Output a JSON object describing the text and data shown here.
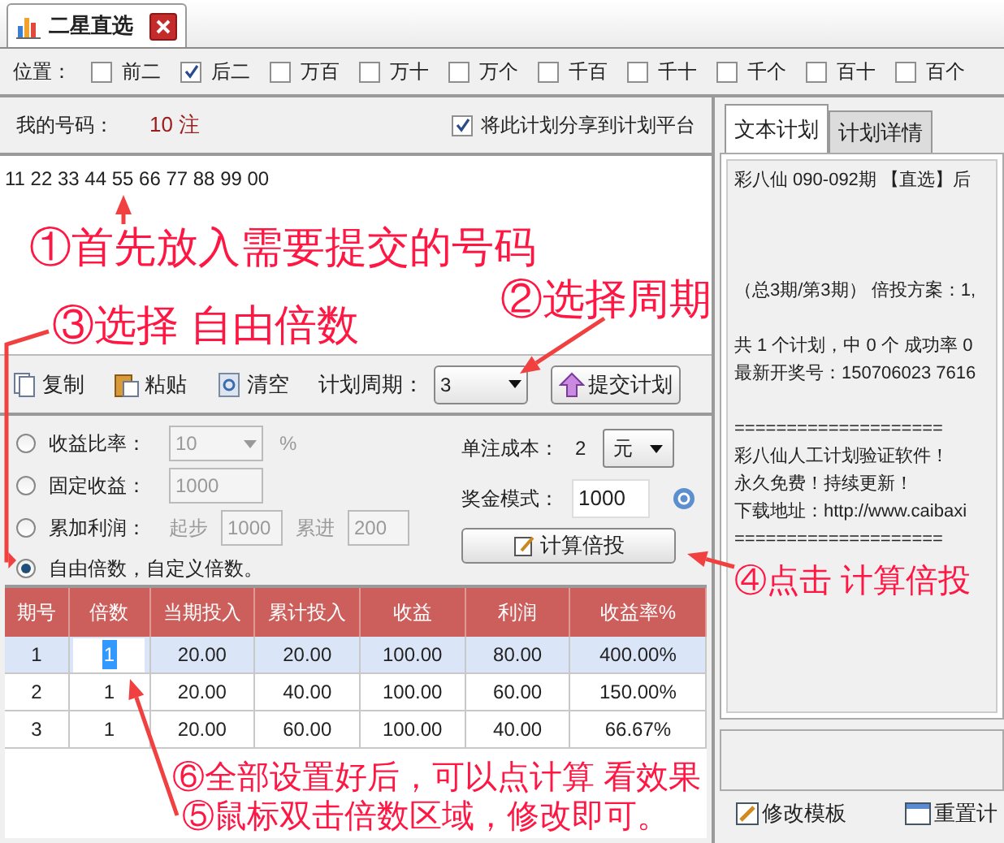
{
  "tab": {
    "title": "二星直选"
  },
  "position": {
    "label": "位置：",
    "options": [
      {
        "label": "前二",
        "checked": false
      },
      {
        "label": "后二",
        "checked": true
      },
      {
        "label": "万百",
        "checked": false
      },
      {
        "label": "万十",
        "checked": false
      },
      {
        "label": "万个",
        "checked": false
      },
      {
        "label": "千百",
        "checked": false
      },
      {
        "label": "千十",
        "checked": false
      },
      {
        "label": "千个",
        "checked": false
      },
      {
        "label": "百十",
        "checked": false
      },
      {
        "label": "百个",
        "checked": false
      }
    ]
  },
  "my_numbers": {
    "label": "我的号码：",
    "count": "10 注",
    "share": {
      "label": "将此计划分享到计划平台",
      "checked": true
    },
    "value": "11 22 33 44 55 66 77 88 99 00"
  },
  "toolbar": {
    "buttons": [
      "复制",
      "粘贴",
      "清空"
    ],
    "period_label": "计划周期：",
    "period": "3",
    "submit": "提交计划"
  },
  "options": [
    {
      "kind": "ratio",
      "label": "收益比率：",
      "selected": false,
      "disabled": true,
      "value": "10",
      "unit": "%"
    },
    {
      "kind": "fixed",
      "label": "固定收益：",
      "selected": false,
      "disabled": true,
      "value": "1000"
    },
    {
      "kind": "cumulative",
      "label": "累加利润：",
      "selected": false,
      "disabled": true,
      "start_label": "起步",
      "start": "1000",
      "step_label": "累进",
      "step": "200"
    },
    {
      "kind": "free",
      "label": "自由倍数，自定义倍数。",
      "selected": true
    }
  ],
  "cost": {
    "label": "单注成本：",
    "value": "2",
    "unit": "元"
  },
  "prize": {
    "label": "奖金模式：",
    "value": "1000"
  },
  "calc_button": "计算倍投",
  "table": {
    "columns": [
      "期号",
      "倍数",
      "当期投入",
      "累计投入",
      "收益",
      "利润",
      "收益率%"
    ],
    "rows": [
      {
        "selected": true,
        "cells": [
          "1",
          "1",
          "20.00",
          "20.00",
          "100.00",
          "80.00",
          "400.00%"
        ]
      },
      {
        "selected": false,
        "cells": [
          "2",
          "1",
          "20.00",
          "40.00",
          "100.00",
          "60.00",
          "150.00%"
        ]
      },
      {
        "selected": false,
        "cells": [
          "3",
          "1",
          "20.00",
          "60.00",
          "100.00",
          "40.00",
          "66.67%"
        ]
      }
    ]
  },
  "right_tabs": [
    {
      "label": "文本计划",
      "selected": true
    },
    {
      "label": "计划详情",
      "selected": false
    }
  ],
  "plan_text": [
    [
      "彩八仙 090-092期 【直选】后"
    ],
    [
      "（总3期/第3期） 倍投方案：1,"
    ],
    [
      "共 1 个计划，中 0 个 成功率 0",
      "最新开奖号：150706023 7616"
    ],
    [
      "====================",
      "彩八仙人工计划验证软件！",
      "永久免费！持续更新！",
      "下载地址：http://www.caibaxi",
      "===================="
    ]
  ],
  "bottom_buttons": [
    "修改模板",
    "重置计"
  ],
  "annotations": [
    "①首先放入需要提交的号码",
    "②选择周期",
    "③选择 自由倍数",
    "④点击 计算倍投",
    "⑥全部设置好后，可以点计算 看效果",
    "⑤鼠标双击倍数区域，修改即可。"
  ]
}
